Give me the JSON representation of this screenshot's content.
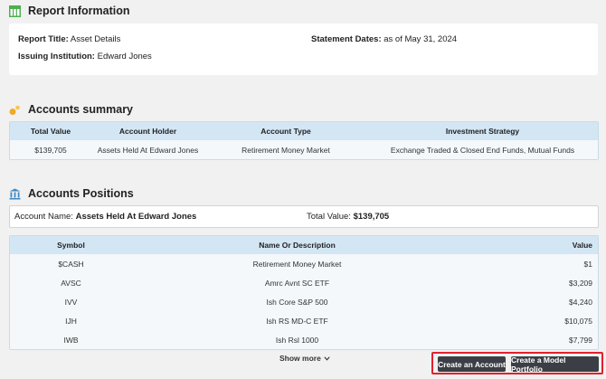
{
  "report": {
    "title": "Report Information",
    "report_title_label": "Report Title:",
    "report_title_value": "Asset Details",
    "statement_dates_label": "Statement Dates:",
    "statement_dates_value": "as of May 31, 2024",
    "institution_label": "Issuing Institution:",
    "institution_value": "Edward Jones"
  },
  "summary": {
    "title": "Accounts summary",
    "headers": [
      "Total Value",
      "Account Holder",
      "Account Type",
      "Investment Strategy"
    ],
    "rows": [
      [
        "$139,705",
        "Assets Held At Edward Jones",
        "Retirement Money Market",
        "Exchange Traded & Closed End Funds, Mutual Funds"
      ]
    ]
  },
  "positions": {
    "title": "Accounts Positions",
    "account_name_label": "Account Name:",
    "account_name_value": "Assets Held At Edward Jones",
    "total_value_label": "Total Value:",
    "total_value_value": "$139,705",
    "headers": [
      "Symbol",
      "Name Or Description",
      "Value"
    ],
    "rows": [
      [
        "$CASH",
        "Retirement Money Market",
        "$1"
      ],
      [
        "AVSC",
        "Amrc Avnt SC ETF",
        "$3,209"
      ],
      [
        "IVV",
        "Ish Core S&P 500",
        "$4,240"
      ],
      [
        "IJH",
        "Ish RS MD-C ETF",
        "$10,075"
      ],
      [
        "IWB",
        "Ish Rsl 1000",
        "$7,799"
      ]
    ],
    "show_more_label": "Show more"
  },
  "actions": {
    "create_account_label": "Create an Account",
    "create_model_portfolio_label": "Create a Model Portfolio"
  },
  "colors": {
    "header_bg": "#d3e6f4",
    "button_bg": "#3b3f45",
    "highlight_border": "#e0212b",
    "report_icon": "#4caf50",
    "summary_icon": "#f0a92a",
    "positions_icon": "#3f88c5"
  },
  "icons": {
    "report": "table-icon",
    "summary": "coins-icon",
    "positions": "bank-icon"
  }
}
